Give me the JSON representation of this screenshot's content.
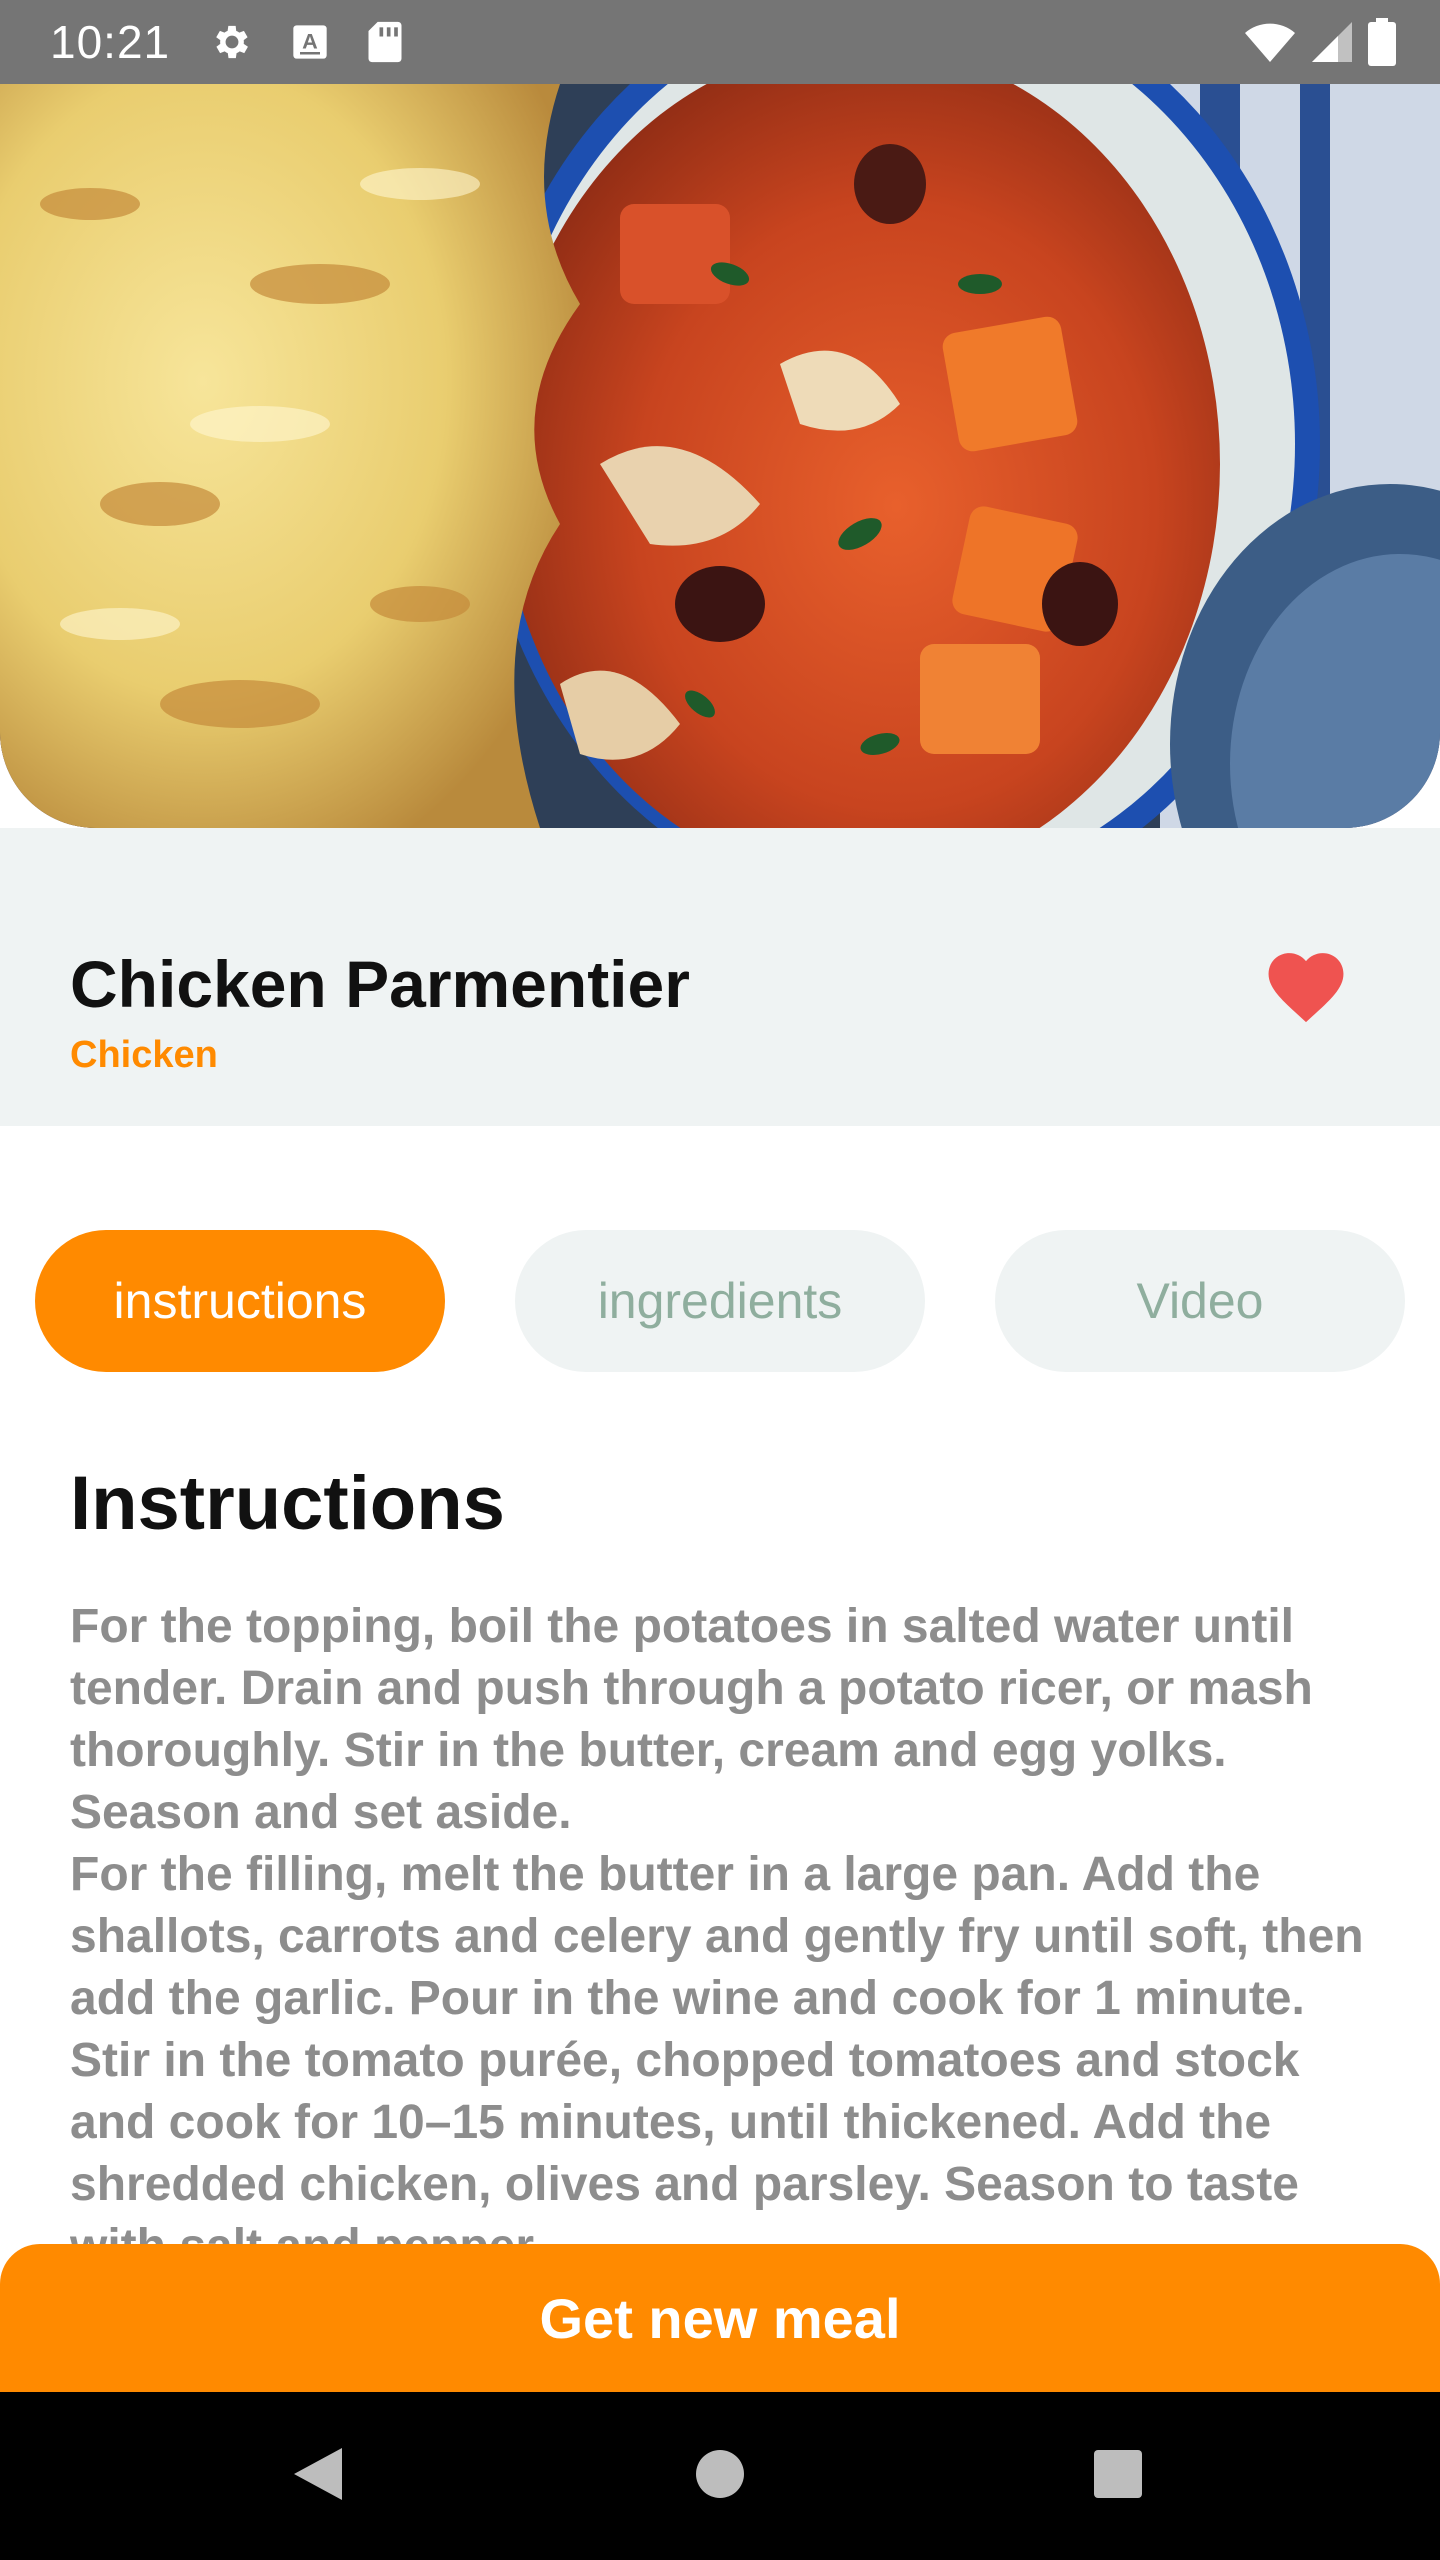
{
  "status_bar": {
    "time": "10:21",
    "left_icons": [
      "gear-icon",
      "keyboard-a-icon",
      "sd-card-icon"
    ],
    "right_icons": [
      "wifi-icon",
      "signal-icon",
      "battery-icon"
    ]
  },
  "hero": {
    "image": "chicken-parmentier-photo"
  },
  "meal": {
    "title": "Chicken Parmentier",
    "category": "Chicken",
    "favorite_icon": "heart-icon",
    "favorite_color": "#ef5350"
  },
  "tabs": [
    {
      "label": "instructions",
      "active": true
    },
    {
      "label": "ingredients",
      "active": false
    },
    {
      "label": "Video",
      "active": false
    }
  ],
  "instructions": {
    "heading": "Instructions",
    "paragraphs": [
      "For the topping, boil the potatoes in salted water until tender. Drain and push through a potato ricer, or mash thoroughly. Stir in the butter, cream and egg yolks. Season and set aside.",
      "For the filling, melt the butter in a large pan. Add the shallots, carrots and celery and gently fry until soft, then add the garlic. Pour in the wine and cook for 1 minute. Stir in the tomato purée, chopped tomatoes and stock and cook for 10–15 minutes, until thickened. Add the shredded chicken, olives and parsley. Season to taste with salt and pepper."
    ]
  },
  "action_button": {
    "label": "Get new meal"
  },
  "nav_bar": {
    "buttons": [
      "back-icon",
      "home-icon",
      "recents-icon"
    ]
  },
  "colors": {
    "accent": "#ff8a00",
    "surface": "#eff3f3",
    "tab_inactive_text": "#8fae9e",
    "body_text": "#8d8d8d"
  }
}
